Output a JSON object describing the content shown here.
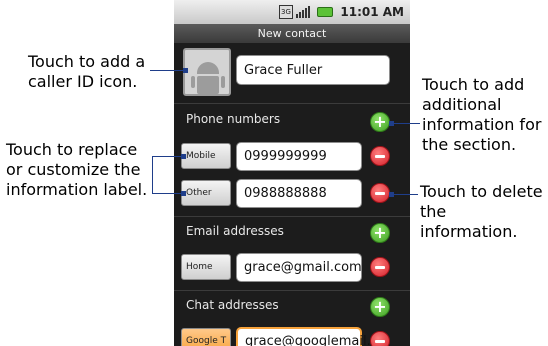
{
  "callouts": {
    "add_icon": [
      "Touch to add a",
      "caller ID icon."
    ],
    "replace_label": [
      "Touch to replace",
      "or customize the",
      "information label."
    ],
    "add_info": [
      "Touch to add",
      "additional",
      "information for",
      "the section."
    ],
    "delete_info": [
      "Touch to delete",
      "the information."
    ]
  },
  "status": {
    "time": "11:01 AM",
    "net_label": "3G"
  },
  "title": "New contact",
  "contact": {
    "name": "Grace Fuller"
  },
  "phones": {
    "section": "Phone numbers",
    "rows": [
      {
        "label": "Mobile",
        "value": "0999999999"
      },
      {
        "label": "Other",
        "value": "0988888888"
      }
    ]
  },
  "emails": {
    "section": "Email addresses",
    "rows": [
      {
        "label": "Home",
        "value": "grace@gmail.com"
      }
    ]
  },
  "chats": {
    "section": "Chat addresses",
    "rows": [
      {
        "label": "Google T",
        "value": "grace@googlemail.c"
      }
    ]
  },
  "colors": {
    "plus": "#3e9e22",
    "minus": "#d3202a",
    "callout_line": "#1f3e8a",
    "focus": "#f7a33c"
  }
}
